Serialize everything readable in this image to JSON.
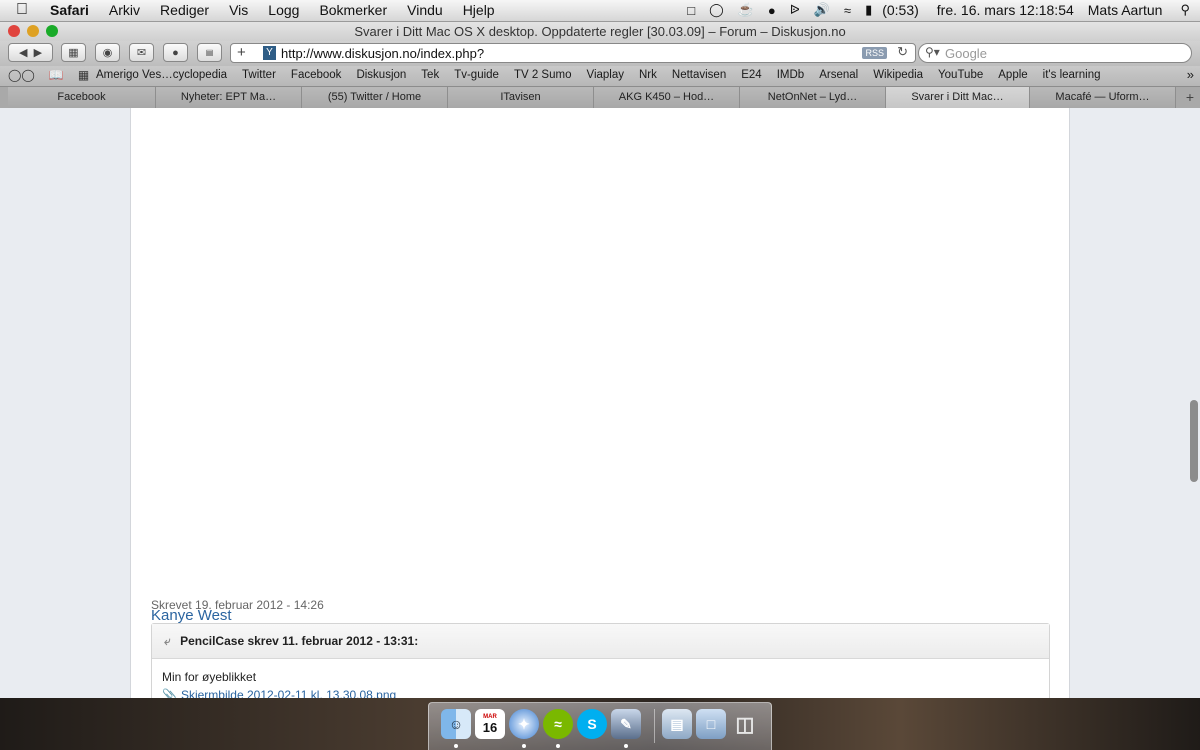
{
  "menubar": {
    "app": "Safari",
    "menus": [
      "Arkiv",
      "Rediger",
      "Vis",
      "Logg",
      "Bokmerker",
      "Vindu",
      "Hjelp"
    ],
    "battery": "(0:53)",
    "datetime": "fre. 16. mars  12:18:54",
    "user": "Mats Aartun"
  },
  "window": {
    "title": "Svarer i Ditt Mac OS X desktop. Oppdaterte regler [30.03.09] – Forum – Diskusjon.no"
  },
  "toolbar": {
    "url": "http://www.diskusjon.no/index.php?",
    "rss": "RSS",
    "search_placeholder": "Google"
  },
  "bookmarks": [
    "Amerigo Ves…cyclopedia",
    "Twitter",
    "Facebook",
    "Diskusjon",
    "Tek",
    "Tv-guide",
    "TV 2 Sumo",
    "Viaplay",
    "Nrk",
    "Nettavisen",
    "E24",
    "IMDb",
    "Arsenal",
    "Wikipedia",
    "YouTube",
    "Apple",
    "it's learning"
  ],
  "tabs": [
    {
      "label": "Facebook"
    },
    {
      "label": "Nyheter: EPT Ma…"
    },
    {
      "label": "(55) Twitter / Home"
    },
    {
      "label": "ITavisen"
    },
    {
      "label": "AKG K450 – Hod…"
    },
    {
      "label": "NetOnNet – Lyd…"
    },
    {
      "label": "Svarer i Ditt Mac…"
    },
    {
      "label": "Macafé — Uform…"
    }
  ],
  "post": {
    "date": "Skrevet 19. februar 2012 - 14:26",
    "author": "Kanye West",
    "quote_header": "PencilCase skrev 11. februar 2012 - 13:31:",
    "quote_text": "Min for øyeblikket",
    "attachment": "Skjermbilde 2012-02-11 kl. 13.30.08.png"
  },
  "dock": {
    "calendar_day": "16",
    "calendar_month": "MAR",
    "items": [
      "finder-icon",
      "calendar-icon",
      "safari-icon",
      "spotify-icon",
      "skype-icon",
      "photo-app-icon",
      "documents-stack-icon",
      "folder-stack-icon",
      "trash-icon"
    ]
  }
}
